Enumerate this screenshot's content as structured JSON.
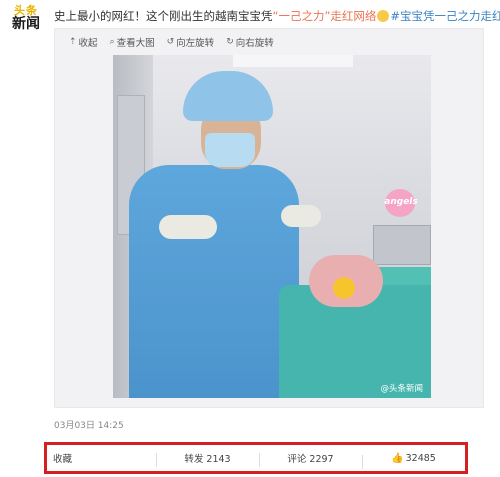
{
  "source": {
    "logo_line1": "头条",
    "logo_line2": "新闻"
  },
  "post": {
    "text_part1": "史上最小的网红！这个刚出生的越南宝宝凭",
    "highlight": "“一己之力”走红网络",
    "tag": "#宝宝凭一己之力走红#"
  },
  "media_toolbar": [
    {
      "icon": "collapse-icon",
      "label": "收起"
    },
    {
      "icon": "zoom-icon",
      "label": "查看大图"
    },
    {
      "icon": "rotate-left-icon",
      "label": "向左旋转"
    },
    {
      "icon": "rotate-right-icon",
      "label": "向右旋转"
    }
  ],
  "photo": {
    "sticker_text": "angels",
    "watermark": "@头条新闻"
  },
  "timestamp": "03月03日 14:25",
  "actions": {
    "favorite": "收藏",
    "repost": "转发 2143",
    "comment": "评论 2297",
    "like": "32485"
  }
}
